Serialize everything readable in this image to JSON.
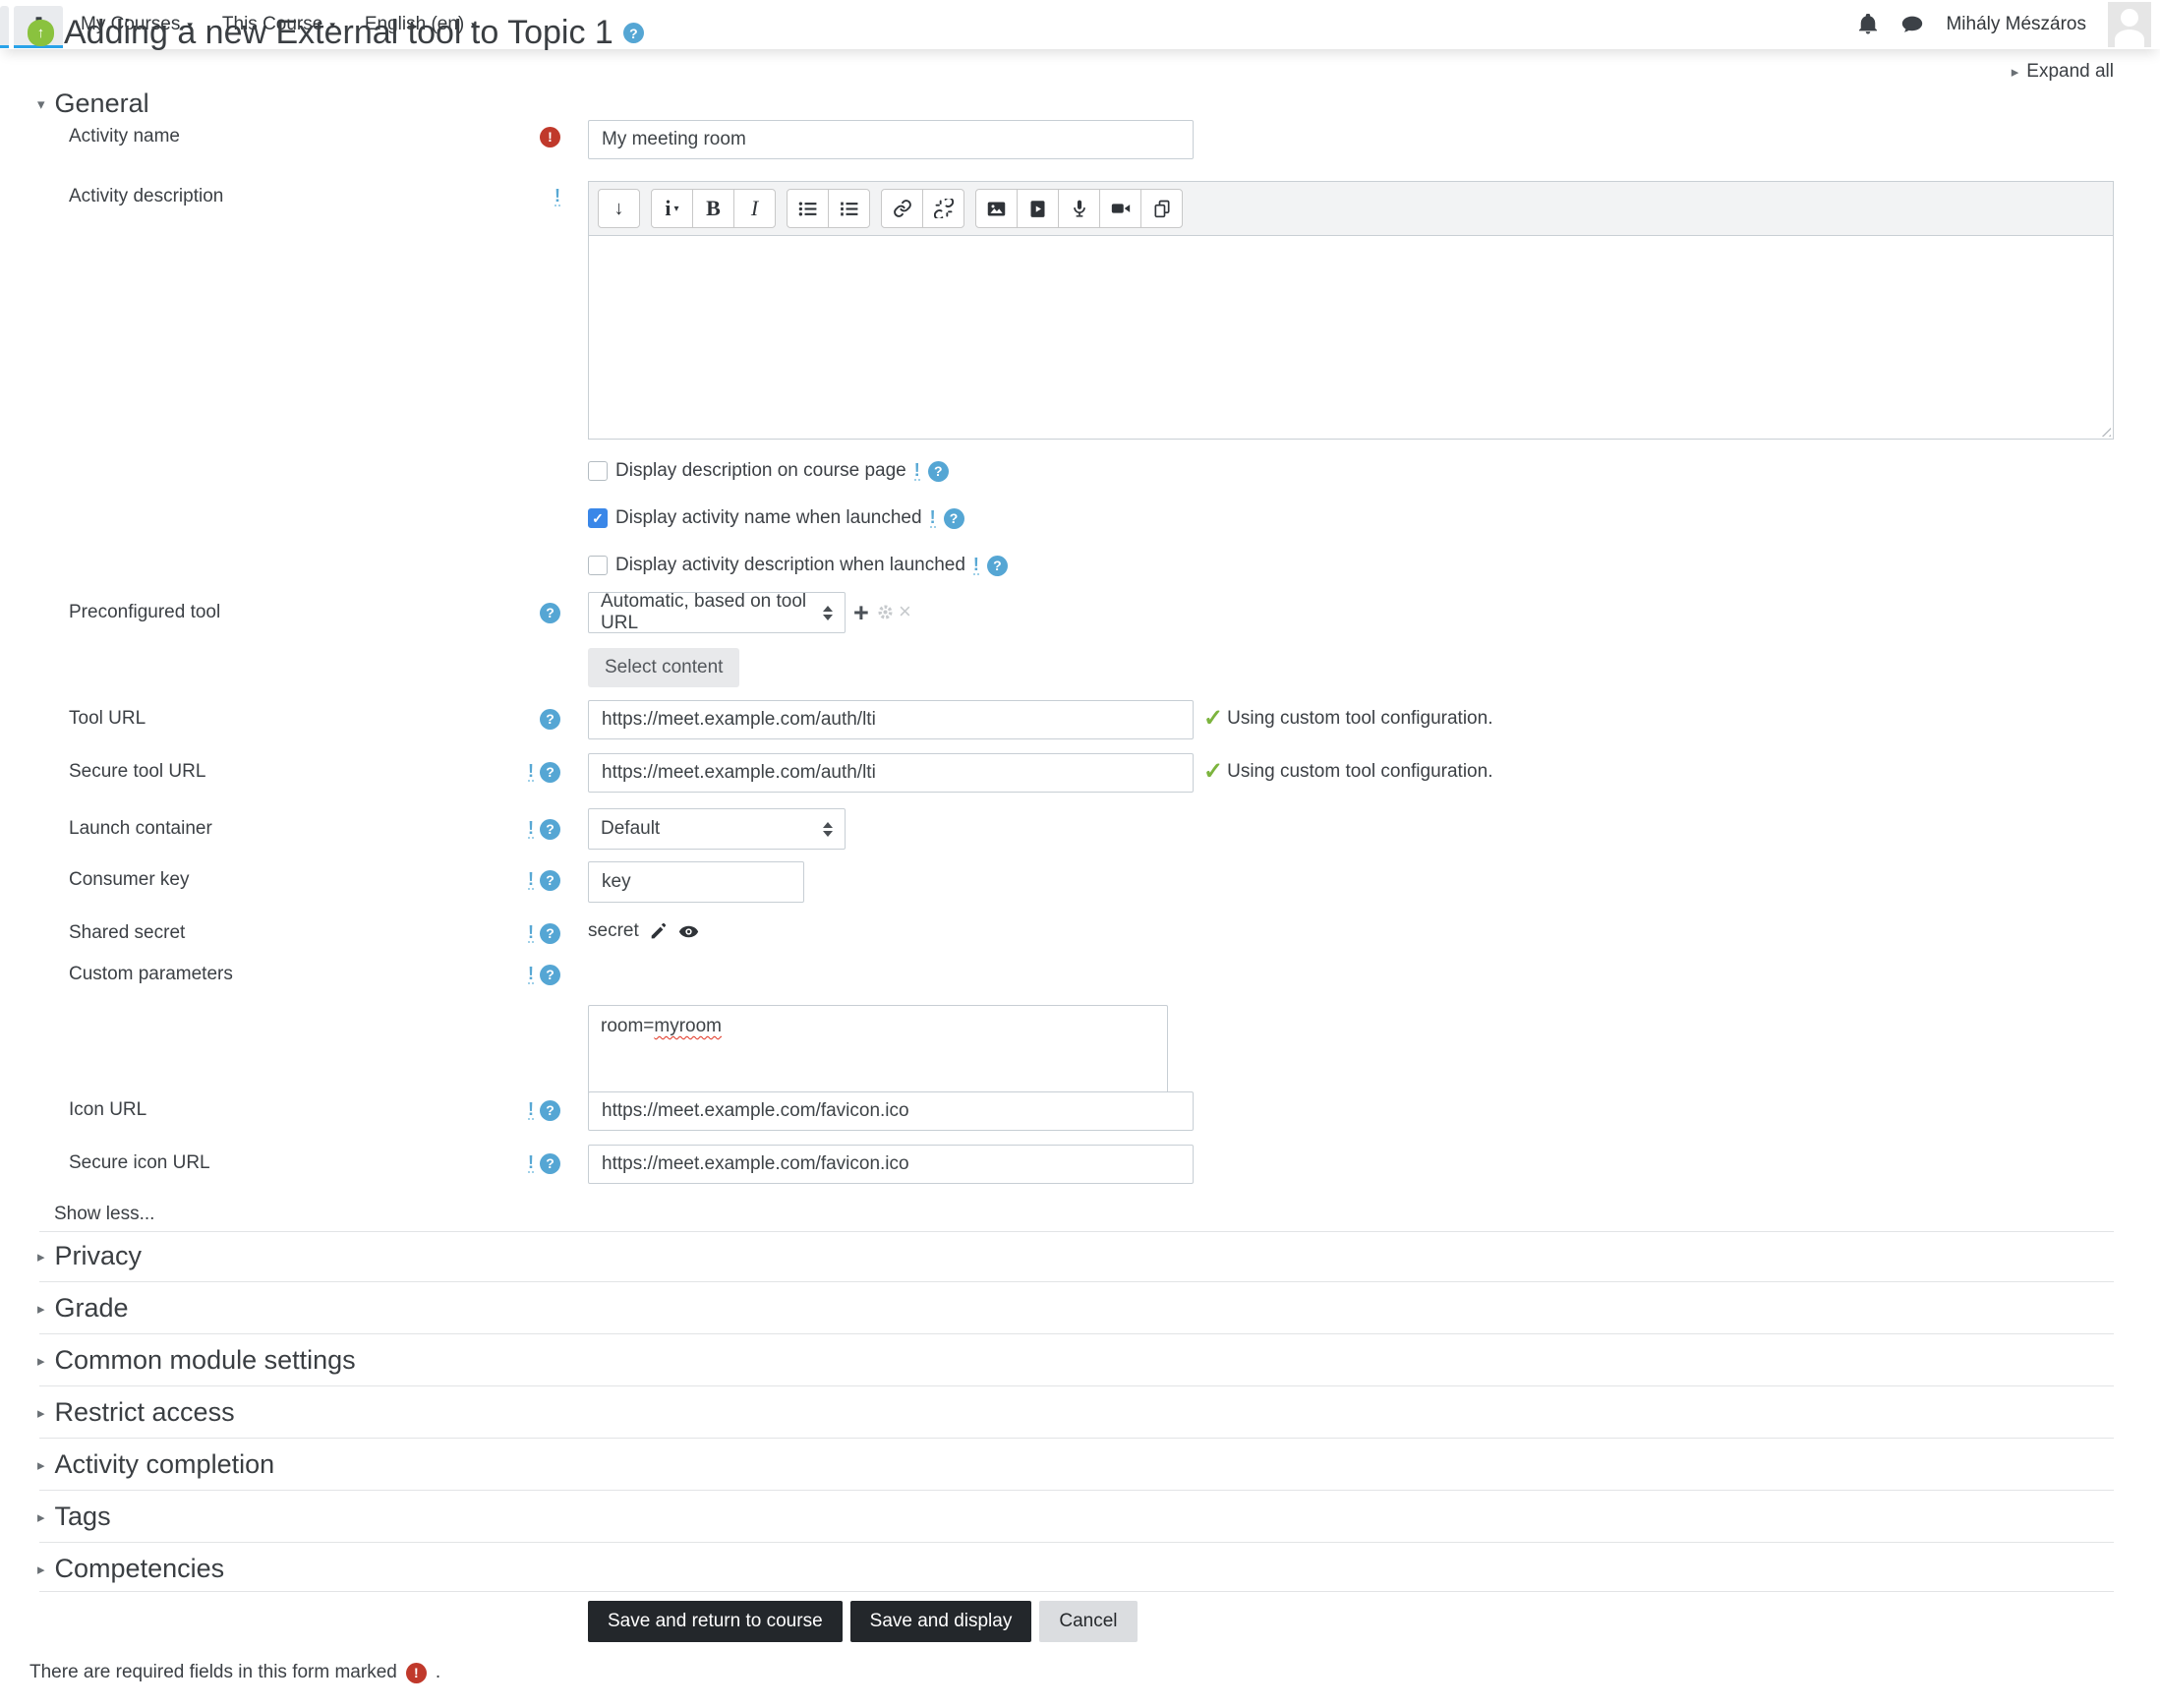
{
  "page": {
    "title": "Adding a new External tool to Topic 1",
    "expand_all": "Expand all",
    "show_less": "Show less..."
  },
  "navbar": {
    "menus": [
      {
        "label": "My Courses"
      },
      {
        "label": "This Course"
      },
      {
        "label": "English (en)"
      }
    ],
    "user_name": "Mihály Mészáros"
  },
  "general": {
    "heading": "General",
    "activity_name": {
      "label": "Activity name",
      "value": "My meeting room"
    },
    "activity_description": {
      "label": "Activity description",
      "value": ""
    },
    "checkboxes": [
      {
        "label": "Display description on course page",
        "checked": false
      },
      {
        "label": "Display activity name when launched",
        "checked": true
      },
      {
        "label": "Display activity description when launched",
        "checked": false
      }
    ],
    "preconfigured_tool": {
      "label": "Preconfigured tool",
      "value": "Automatic, based on tool URL",
      "select_content": "Select content"
    },
    "tool_url": {
      "label": "Tool URL",
      "value": "https://meet.example.com/auth/lti",
      "status": "Using custom tool configuration."
    },
    "secure_tool_url": {
      "label": "Secure tool URL",
      "value": "https://meet.example.com/auth/lti",
      "status": "Using custom tool configuration."
    },
    "launch_container": {
      "label": "Launch container",
      "value": "Default"
    },
    "consumer_key": {
      "label": "Consumer key",
      "value": "key"
    },
    "shared_secret": {
      "label": "Shared secret",
      "value": "secret"
    },
    "custom_parameters": {
      "label": "Custom parameters",
      "value_prefix": "room=",
      "value_misspelled": "myroom"
    },
    "icon_url": {
      "label": "Icon URL",
      "value": "https://meet.example.com/favicon.ico"
    },
    "secure_icon_url": {
      "label": "Secure icon URL",
      "value": "https://meet.example.com/favicon.ico"
    }
  },
  "editor": {
    "style_button": "i",
    "bold_button": "B",
    "italic_button": "I"
  },
  "sections": [
    {
      "label": "Privacy"
    },
    {
      "label": "Grade"
    },
    {
      "label": "Common module settings"
    },
    {
      "label": "Restrict access"
    },
    {
      "label": "Activity completion"
    },
    {
      "label": "Tags"
    },
    {
      "label": "Competencies"
    }
  ],
  "actions": {
    "save_return": "Save and return to course",
    "save_display": "Save and display",
    "cancel": "Cancel"
  },
  "footer": {
    "required_note": "There are required fields in this form marked",
    "period": "."
  },
  "icons": {
    "help": "?",
    "required": "!",
    "advanced": "!",
    "collapsed_arrow": "▸",
    "expanded_arrow": "▾",
    "menu_caret": "▾",
    "green_check": "✓",
    "tool_arrow": "↑",
    "add": "+",
    "delete": "×",
    "toolbar_collapse": "↓",
    "accent_blue": "#29a3e9",
    "brand_green": "#8ac23e",
    "status_green": "#7cb43e",
    "required_red": "#c0392b",
    "help_blue": "#55a6d4"
  }
}
